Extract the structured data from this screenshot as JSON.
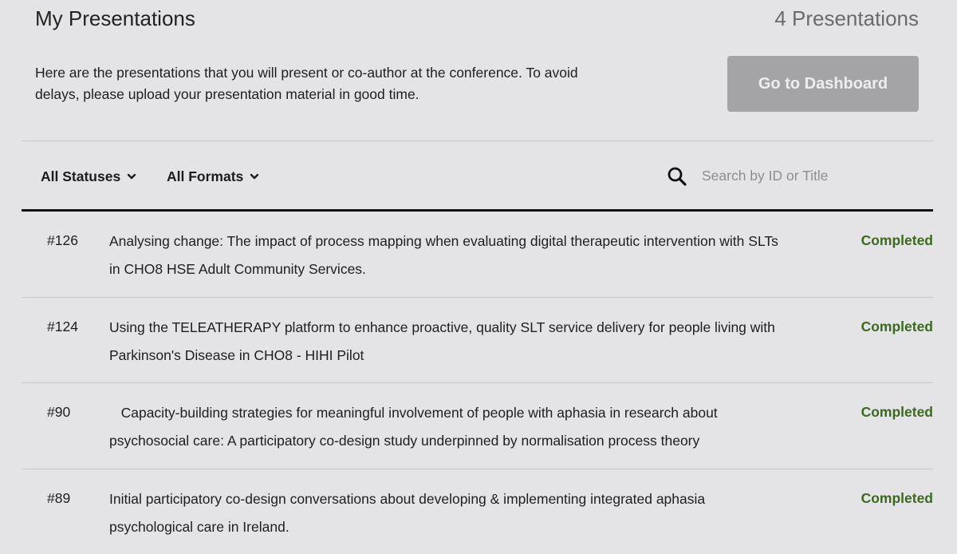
{
  "header": {
    "title": "My Presentations",
    "count_text": "4 Presentations",
    "intro": "Here are the presentations that you will present or co-author at the conference. To avoid delays, please upload your presentation material in good time.",
    "dashboard_button": "Go to Dashboard"
  },
  "filters": {
    "status_label": "All Statuses",
    "format_label": "All Formats",
    "search_placeholder": "Search by ID or Title"
  },
  "presentations": [
    {
      "id": "#126",
      "title": "Analysing change: The impact of process mapping when evaluating digital therapeutic intervention with SLTs in CHO8 HSE Adult Community Services.",
      "status": "Completed"
    },
    {
      "id": "#124",
      "title": "Using the TELEATHERAPY platform to enhance proactive, quality SLT service delivery for people living with Parkinson's Disease in CHO8 - HIHI Pilot",
      "status": "Completed"
    },
    {
      "id": "#90",
      "title": "   Capacity-building strategies for meaningful involvement of people with aphasia in research about psychosocial care: A participatory co-design study underpinned by normalisation process theory",
      "status": "Completed"
    },
    {
      "id": "#89",
      "title": "Initial participatory co-design conversations about developing & implementing integrated aphasia psychological care in Ireland.",
      "status": "Completed"
    }
  ],
  "colors": {
    "background": "#e4e4e6",
    "status_completed": "#3b6a1f",
    "button_disabled": "#a4a4a6"
  }
}
